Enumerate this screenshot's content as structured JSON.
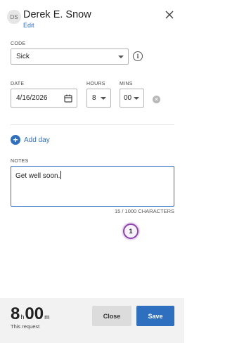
{
  "header": {
    "avatar_initials": "DS",
    "person_name": "Derek E. Snow",
    "edit_label": "Edit"
  },
  "code": {
    "label": "CODE",
    "value": "Sick"
  },
  "date": {
    "label": "DATE",
    "value": "4/16/2026"
  },
  "hours": {
    "label": "HOURS",
    "value": "8"
  },
  "mins": {
    "label": "MINS",
    "value": "00"
  },
  "add_day_label": "Add day",
  "notes": {
    "label": "NOTES",
    "value": "Get well soon.",
    "char_count": "15 / 1000 CHARACTERS"
  },
  "step_badge": "1",
  "footer": {
    "hours_value": "8",
    "hours_unit": "h",
    "mins_value": "00",
    "mins_unit": "m",
    "subtitle": "This request",
    "close_label": "Close",
    "save_label": "Save"
  },
  "colors": {
    "accent": "#2f6fbf",
    "footer_bg": "#f2f2f2",
    "badge_ring": "#8e44ad"
  }
}
